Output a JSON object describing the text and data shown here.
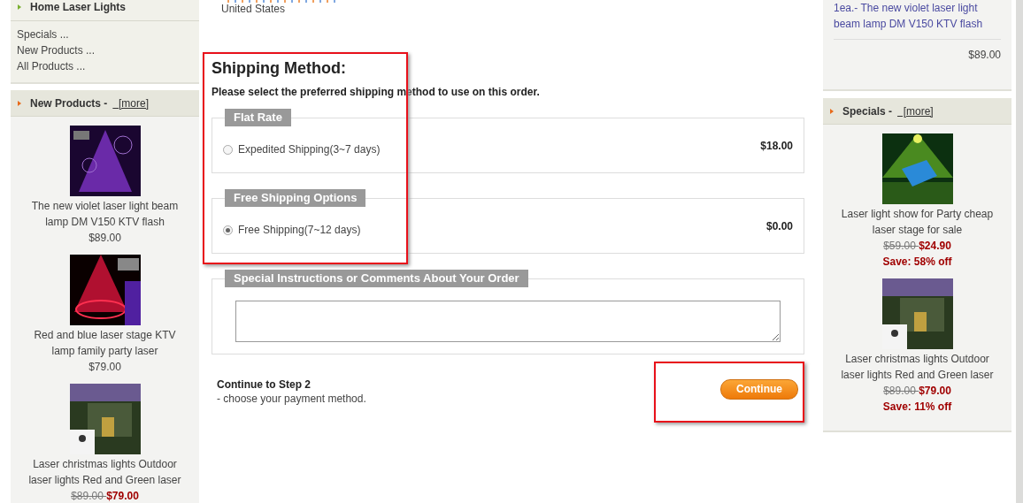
{
  "left_sidebar": {
    "header": "Home Laser Lights",
    "links": [
      "Specials ...",
      "New Products ...",
      "All Products ..."
    ],
    "new_products": {
      "title": "New Products - ",
      "more": "  [more]",
      "items": [
        {
          "kind": "regular",
          "name": "The new violet laser light beam lamp DM V150 KTV flash",
          "price": "$89.00"
        },
        {
          "kind": "regular",
          "name": "Red and blue laser stage KTV lamp family party laser",
          "price": "$79.00"
        },
        {
          "kind": "sale",
          "name": "Laser christmas lights Outdoor laser lights Red and Green laser",
          "old_price": "$89.00 ",
          "price": "$79.00"
        }
      ]
    }
  },
  "address": {
    "country": "United States"
  },
  "shipping": {
    "title": "Shipping Method:",
    "intro": "Please select the preferred shipping method to use on this order.",
    "groups": [
      {
        "legend": "Flat Rate",
        "options": [
          {
            "label": "Expedited Shipping(3~7 days)",
            "price": "$18.00",
            "selected": false
          }
        ]
      },
      {
        "legend": "Free Shipping Options",
        "options": [
          {
            "label": "Free Shipping(7~12 days)",
            "price": "$0.00",
            "selected": true
          }
        ]
      }
    ]
  },
  "comments": {
    "legend": "Special Instructions or Comments About Your Order"
  },
  "continue": {
    "title": "Continue to Step 2",
    "subtitle": "- choose your payment method.",
    "button": "Continue"
  },
  "right_sidebar": {
    "cart_item": "1ea.- The new violet laser light beam lamp DM V150 KTV flash",
    "cart_total": "$89.00",
    "specials": {
      "title": "Specials - ",
      "more": "  [more]",
      "items": [
        {
          "kind": "sale",
          "name": "Laser light show for Party cheap laser stage for sale",
          "old_price": "$59.00 ",
          "price": "$24.90",
          "save": "Save: 58% off"
        },
        {
          "kind": "sale",
          "name": "Laser christmas lights Outdoor laser lights Red and Green laser",
          "old_price": "$89.00 ",
          "price": "$79.00",
          "save": "Save: 11% off"
        }
      ]
    }
  }
}
